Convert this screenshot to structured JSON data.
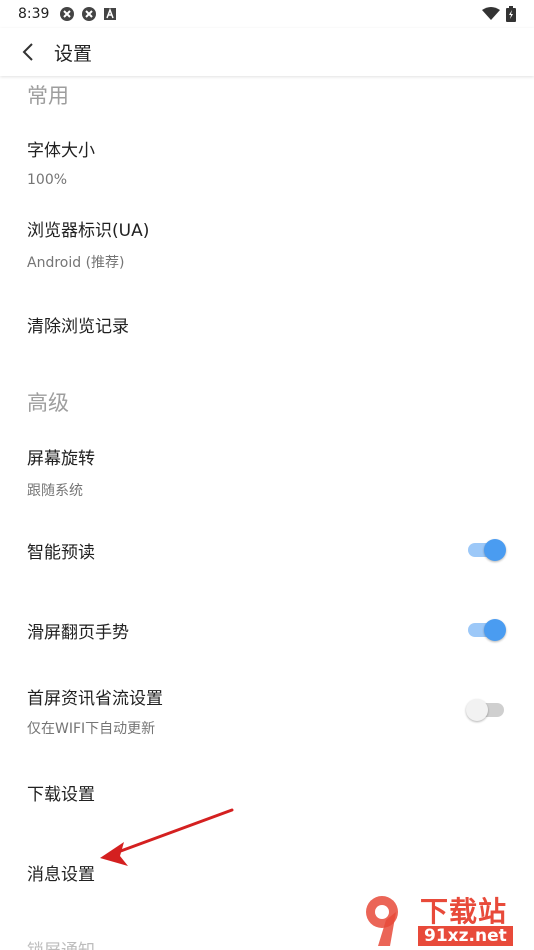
{
  "status_bar": {
    "time": "8:39"
  },
  "app_bar": {
    "title": "设置"
  },
  "sections": {
    "common": "常用",
    "advanced": "高级"
  },
  "prefs": {
    "font_size": {
      "title": "字体大小",
      "summary": "100%"
    },
    "user_agent": {
      "title": "浏览器标识(UA)",
      "summary": "Android (推荐)"
    },
    "clear_history": {
      "title": "清除浏览记录"
    },
    "screen_rotation": {
      "title": "屏幕旋转",
      "summary": "跟随系统"
    },
    "smart_preload": {
      "title": "智能预读",
      "enabled": true
    },
    "swipe_page": {
      "title": "滑屏翻页手势",
      "enabled": true
    },
    "data_saver": {
      "title": "首屏资讯省流设置",
      "summary": "仅在WIFI下自动更新",
      "enabled": false
    },
    "download_settings": {
      "title": "下载设置"
    },
    "message_settings": {
      "title": "消息设置"
    },
    "lock_screen_notice": {
      "title": "锁屏通知"
    }
  },
  "watermark": {
    "text": "下载站",
    "url": "91xz.net"
  },
  "colors": {
    "switch_on": "#4a9cf1",
    "switch_track_on": "#9cc8f8",
    "arrow": "#e02020"
  }
}
